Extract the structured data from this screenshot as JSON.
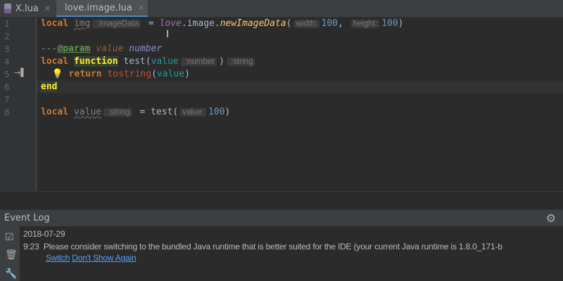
{
  "tabs": [
    {
      "label": "X.lua",
      "active": false
    },
    {
      "label": "love.image.lua",
      "active": true
    }
  ],
  "editor": {
    "line_numbers": [
      "1",
      "2",
      "3",
      "4",
      "5",
      "6",
      "7",
      "8"
    ],
    "lines": [
      [
        {
          "t": "local",
          "c": "kw"
        },
        {
          "t": " "
        },
        {
          "t": "img",
          "c": "unused"
        },
        {
          "t": " :ImageData",
          "c": "hint"
        },
        {
          "t": " = "
        },
        {
          "t": "love",
          "c": "glob"
        },
        {
          "t": ".image."
        },
        {
          "t": "newImageData",
          "c": "call"
        },
        {
          "t": "("
        },
        {
          "t": "width:",
          "c": "hint"
        },
        {
          "t": "100",
          "c": "num"
        },
        {
          "t": ", "
        },
        {
          "t": "height:",
          "c": "hint"
        },
        {
          "t": "100",
          "c": "num"
        },
        {
          "t": ")"
        }
      ],
      [],
      [
        {
          "t": "---",
          "c": "cmt"
        },
        {
          "t": "@param",
          "c": "tag"
        },
        {
          "t": " value",
          "c": "doctype"
        },
        {
          "t": " number",
          "c": "doctype2"
        }
      ],
      [
        {
          "t": "local",
          "c": "kw"
        },
        {
          "t": " "
        },
        {
          "t": "function",
          "c": "kw hl"
        },
        {
          "t": " test("
        },
        {
          "t": "value",
          "c": "param"
        },
        {
          "t": " :number",
          "c": "hint"
        },
        {
          "t": ")"
        },
        {
          "t": " :string",
          "c": "hint"
        }
      ],
      [
        {
          "t": "  💡 "
        },
        {
          "t": "return",
          "c": "kw"
        },
        {
          "t": " "
        },
        {
          "t": "tostring",
          "c": "builtin"
        },
        {
          "t": "("
        },
        {
          "t": "value",
          "c": "param"
        },
        {
          "t": ")"
        }
      ],
      [
        {
          "t": "end",
          "c": "kw hl"
        }
      ],
      [],
      [
        {
          "t": "local",
          "c": "kw"
        },
        {
          "t": " "
        },
        {
          "t": "value",
          "c": "unused"
        },
        {
          "t": " :string",
          "c": "hint"
        },
        {
          "t": " = test("
        },
        {
          "t": "value:",
          "c": "hint"
        },
        {
          "t": "100",
          "c": "num"
        },
        {
          "t": ")"
        }
      ]
    ]
  },
  "event_log": {
    "title": "Event Log",
    "date": "2018-07-29",
    "time": "9:23",
    "message": "Please consider switching to the bundled Java runtime that is better suited for the IDE (your current Java runtime is 1.8.0_171-b",
    "actions": [
      "Switch",
      "Don't Show Again"
    ]
  }
}
